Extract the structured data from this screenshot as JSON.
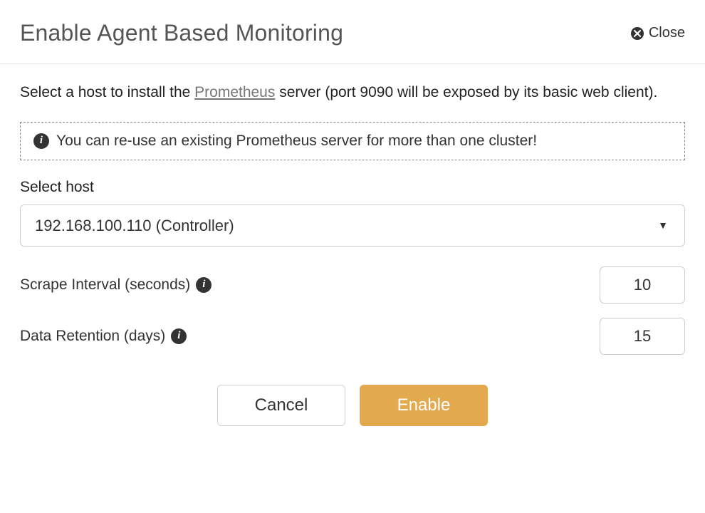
{
  "header": {
    "title": "Enable Agent Based Monitoring",
    "close_label": "Close"
  },
  "body": {
    "instruction_pre": "Select a host to install the ",
    "instruction_link": "Prometheus",
    "instruction_post": " server (port 9090 will be exposed by its basic web client).",
    "info_text": "You can re-use an existing Prometheus server for more than one cluster!",
    "select_host": {
      "label": "Select host",
      "value": "192.168.100.110 (Controller)"
    },
    "scrape_interval": {
      "label": "Scrape Interval (seconds)",
      "value": "10"
    },
    "data_retention": {
      "label": "Data Retention (days)",
      "value": "15"
    }
  },
  "actions": {
    "cancel": "Cancel",
    "enable": "Enable"
  }
}
